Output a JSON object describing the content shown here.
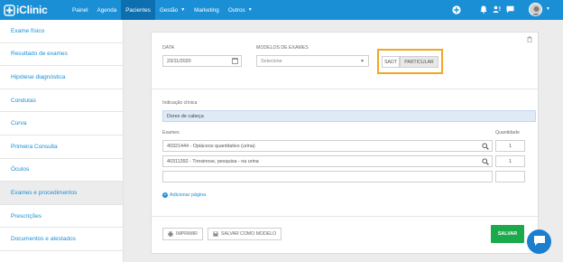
{
  "app": {
    "name": "iClinic"
  },
  "nav": {
    "items": [
      {
        "label": "Painel"
      },
      {
        "label": "Agenda"
      },
      {
        "label": "Pacientes",
        "active": true
      },
      {
        "label": "Gestão",
        "caret": true
      },
      {
        "label": "Marketing"
      },
      {
        "label": "Outros",
        "caret": true
      }
    ],
    "icons": [
      "add-icon",
      "bell-icon",
      "user-alert-icon",
      "chat-icon"
    ],
    "color": "#1a8fd6"
  },
  "sidebar": {
    "items": [
      {
        "label": "Exame físico"
      },
      {
        "label": "Resultado de exames"
      },
      {
        "label": "Hipótese diagnóstica"
      },
      {
        "label": "Condutas"
      },
      {
        "label": "Curva"
      },
      {
        "label": "Primeira Consulta"
      },
      {
        "label": "Óculos"
      },
      {
        "label": "Exames e procedimentos",
        "active": true
      },
      {
        "label": "Prescrições"
      },
      {
        "label": "Documentos e atestados"
      }
    ]
  },
  "form": {
    "date_label": "DATA",
    "date_value": "23/11/2020",
    "model_label": "MODELOS DE EXAMES",
    "model_value": "Selecione",
    "toggle": {
      "option_a": "SADT",
      "option_b": "PARTICULAR",
      "selected": "PARTICULAR",
      "highlight_color": "#f2a623"
    },
    "indication_label": "Indicação clínica",
    "indication_value": "Dores de cabeça",
    "exams_label": "Exames",
    "quantity_label": "Quantidade",
    "exams": [
      {
        "name": "40321444 - Opiáceos quantitativo (urina)",
        "qty": "1"
      },
      {
        "name": "40311392 - Tirosinose, pesquisa - na urina",
        "qty": "1"
      },
      {
        "name": "",
        "qty": ""
      }
    ],
    "add_page_label": "Adicionar página"
  },
  "actions": {
    "print_label": "IMPRIMIR",
    "save_model_label": "SALVAR COMO MODELO",
    "save_label": "SALVAR",
    "save_color": "#1aa94b"
  }
}
